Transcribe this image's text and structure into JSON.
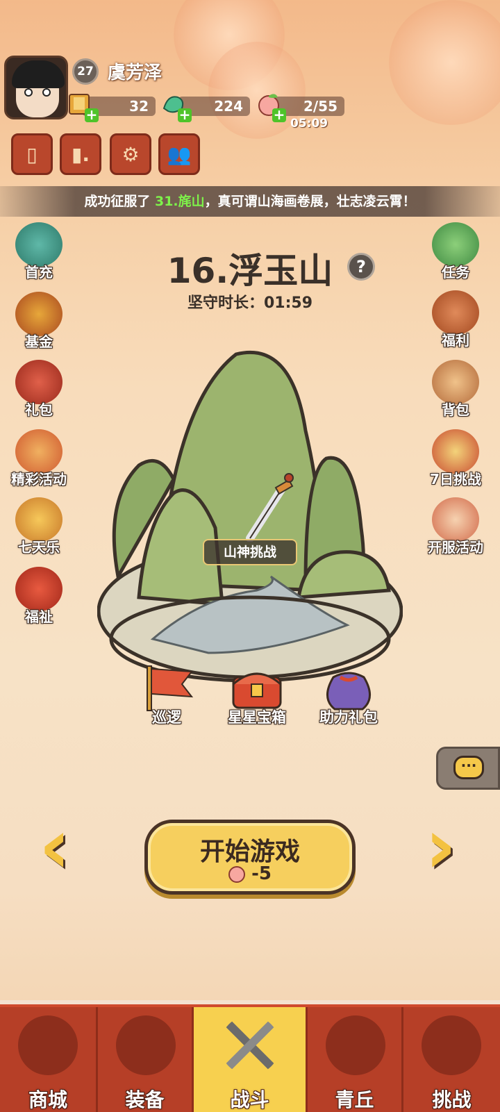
{
  "player": {
    "level": "27",
    "name": "虞芳泽"
  },
  "resources": {
    "scrolls": "32",
    "jade": "224",
    "stamina": "2/55",
    "stamina_timer": "05:09"
  },
  "banner": {
    "prefix": "成功征服了 ",
    "highlight": "31.旄山",
    "suffix": "，真可谓山海画卷展，壮志凌云霄！"
  },
  "stage": {
    "title": "16.浮玉山",
    "help": "?",
    "hold_label": "坚守时长：01:59",
    "challenge_label": "山神挑战"
  },
  "left_menu": [
    "首充",
    "基金",
    "礼包",
    "精彩活动",
    "七天乐",
    "福祉"
  ],
  "right_menu": [
    "任务",
    "福利",
    "背包",
    "7日挑战",
    "开服活动"
  ],
  "rewards": [
    "巡逻",
    "星星宝箱",
    "助力礼包"
  ],
  "start": {
    "label": "开始游戏",
    "cost": "-5"
  },
  "nav": [
    "商城",
    "装备",
    "战斗",
    "青丘",
    "挑战"
  ],
  "nav_active": "战斗",
  "colors": {
    "nav_bg": "#cf4a2e",
    "nav_active": "#f7d04f",
    "start_btn": "#f6cf5e",
    "highlight": "#7ef24a"
  }
}
